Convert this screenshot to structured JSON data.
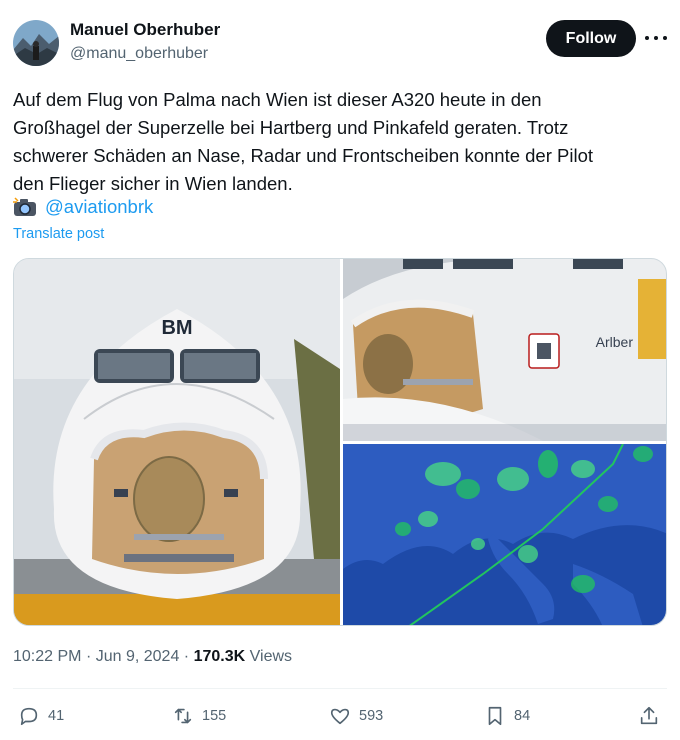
{
  "author": {
    "name": "Manuel Oberhuber",
    "handle": "@manu_oberhuber",
    "avatar_icon": "profile-photo"
  },
  "follow_label": "Follow",
  "more_icon": "more-dots-icon",
  "tweet": {
    "lines": [
      "Auf dem Flug von Palma nach Wien ist dieser A320 heute in den",
      "Großhagel der Superzelle bei Hartberg und Pinkafeld geraten. Trotz",
      "schwerer Schäden an Nase, Radar und Frontscheiben konnte der Pilot",
      "den Flieger sicher in Wien landen."
    ],
    "credit_emoji": "📸",
    "credit_mention": "@aviationbrk",
    "translate_label": "Translate post"
  },
  "media": {
    "image1": {
      "description": "nose-damage-front",
      "nose_text": "BM"
    },
    "image2": {
      "description": "nose-damage-side",
      "airline_text": "Arlber"
    },
    "image3": {
      "description": "radar-weather-map",
      "accent": "#22c55e"
    }
  },
  "meta": {
    "time": "10:22 PM",
    "separator": "·",
    "date": "Jun 9, 2024",
    "views_count": "170.3K",
    "views_label": "Views"
  },
  "actions": {
    "replies": "41",
    "reposts": "155",
    "likes": "593",
    "bookmarks": "84"
  },
  "colors": {
    "link": "#1d9bf0",
    "text": "#0f1419",
    "secondary": "#536471",
    "button": "#0f1419"
  }
}
